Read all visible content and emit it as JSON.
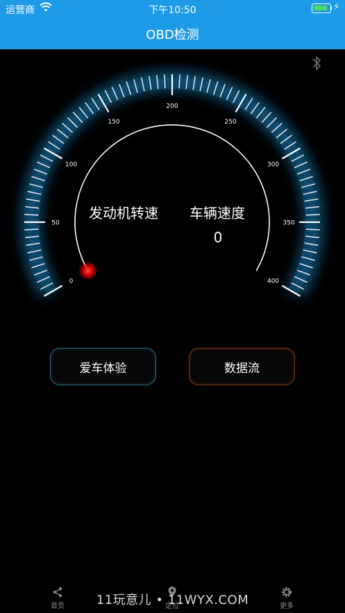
{
  "status_bar": {
    "carrier": "运营商",
    "time": "下午10:50",
    "battery_level": 0.9
  },
  "nav": {
    "title": "OBD检测"
  },
  "gauge": {
    "tick_labels": [
      "0",
      "50",
      "100",
      "150",
      "200",
      "250",
      "300",
      "350",
      "400"
    ],
    "min": 0,
    "max": 400,
    "rpm_label": "发动机转速",
    "speed_label": "车辆速度",
    "speed_value": "0",
    "needle_value": 0,
    "colors": {
      "glow": "#1a8fd0",
      "needle": "#ff1a1a",
      "ticks": "#ffffff"
    }
  },
  "buttons": {
    "experience": "爱车体验",
    "data_stream": "数据流"
  },
  "tabs": [
    {
      "label": "首页",
      "icon": "share-icon"
    },
    {
      "label": "定位",
      "icon": "location-pin-icon"
    },
    {
      "label": "更多",
      "icon": "gear-icon"
    }
  ],
  "watermark": "11玩意儿 • 11WYX.COM"
}
